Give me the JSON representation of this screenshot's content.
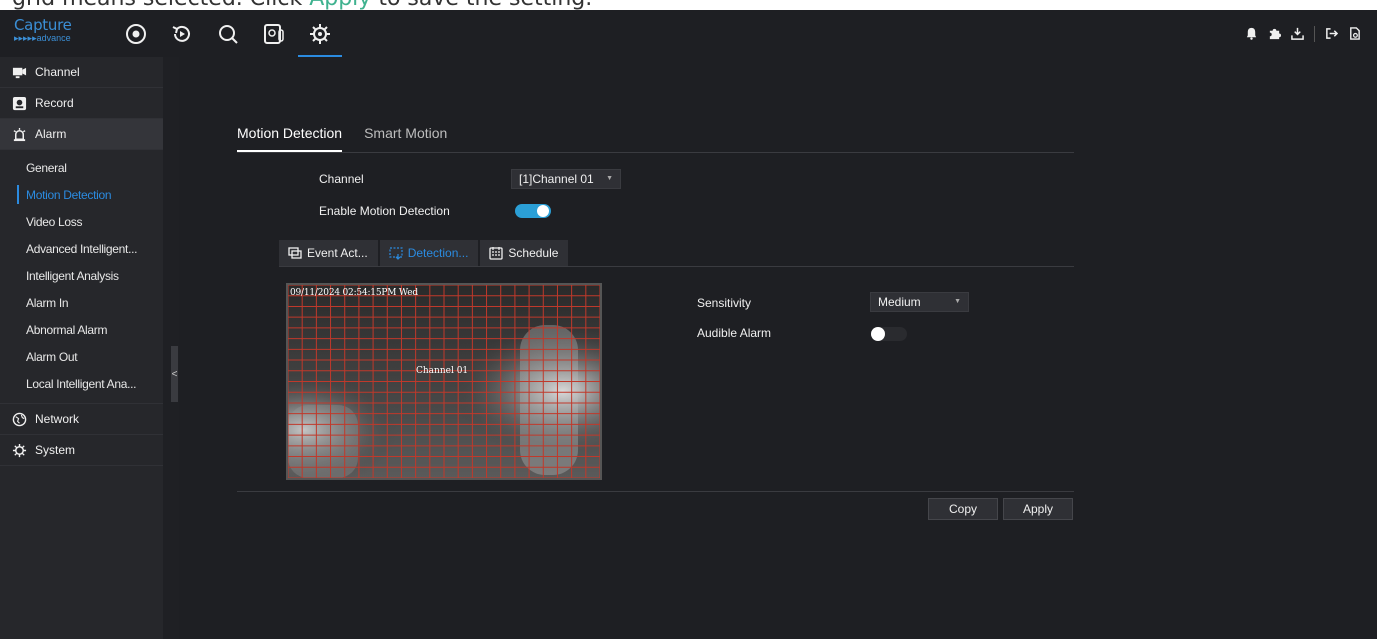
{
  "caption": {
    "text_before": "grid means selected. Click ",
    "highlight": "Apply",
    "text_after": " to save the setting."
  },
  "logo": {
    "line1": "Capture",
    "line2": "▸▸▸▸▸advance"
  },
  "nav": {
    "icons": [
      "live-view-icon",
      "playback-icon",
      "search-icon",
      "intelligent-icon",
      "settings-icon"
    ],
    "active": "settings-icon"
  },
  "topright_icons": [
    "alarm-bell-icon",
    "puzzle-icon",
    "download-icon",
    "logout-icon",
    "lock-screen-icon"
  ],
  "sidebar": {
    "items": [
      {
        "label": "Channel",
        "icon": "camera-channel-icon"
      },
      {
        "label": "Record",
        "icon": "record-icon"
      },
      {
        "label": "Alarm",
        "icon": "alarm-icon"
      },
      {
        "label": "Network",
        "icon": "globe-icon"
      },
      {
        "label": "System",
        "icon": "gear-icon"
      }
    ],
    "alarm_submenu": [
      "General",
      "Motion Detection",
      "Video Loss",
      "Advanced Intelligent...",
      "Intelligent Analysis",
      "Alarm In",
      "Abnormal Alarm",
      "Alarm Out",
      "Local Intelligent Ana..."
    ],
    "active_sub": "Motion Detection",
    "collapse_label": "<"
  },
  "tabs": [
    {
      "label": "Motion Detection",
      "active": true
    },
    {
      "label": "Smart Motion",
      "active": false
    }
  ],
  "form": {
    "channel_label": "Channel",
    "channel_value": "[1]Channel 01",
    "enable_label": "Enable Motion Detection",
    "enable_on": true
  },
  "subtabs": [
    {
      "label": "Event Act...",
      "icon": "event-action-icon",
      "active": false
    },
    {
      "label": "Detection...",
      "icon": "detection-area-icon",
      "active": true
    },
    {
      "label": "Schedule",
      "icon": "calendar-icon",
      "active": false
    }
  ],
  "preview": {
    "timestamp": "09/11/2024 02:54:15PM Wed",
    "channel_name": "Channel 01",
    "grid_color": "#c0392b",
    "grid_cols": 22,
    "grid_rows": 18
  },
  "detection": {
    "sensitivity_label": "Sensitivity",
    "sensitivity_value": "Medium",
    "audible_label": "Audible Alarm",
    "audible_on": false
  },
  "buttons": {
    "copy": "Copy",
    "apply": "Apply"
  },
  "colors": {
    "accent": "#2b8be0",
    "toggle_on": "#2b9fd6",
    "background": "#1e1f23",
    "sidebar": "#26272b"
  }
}
